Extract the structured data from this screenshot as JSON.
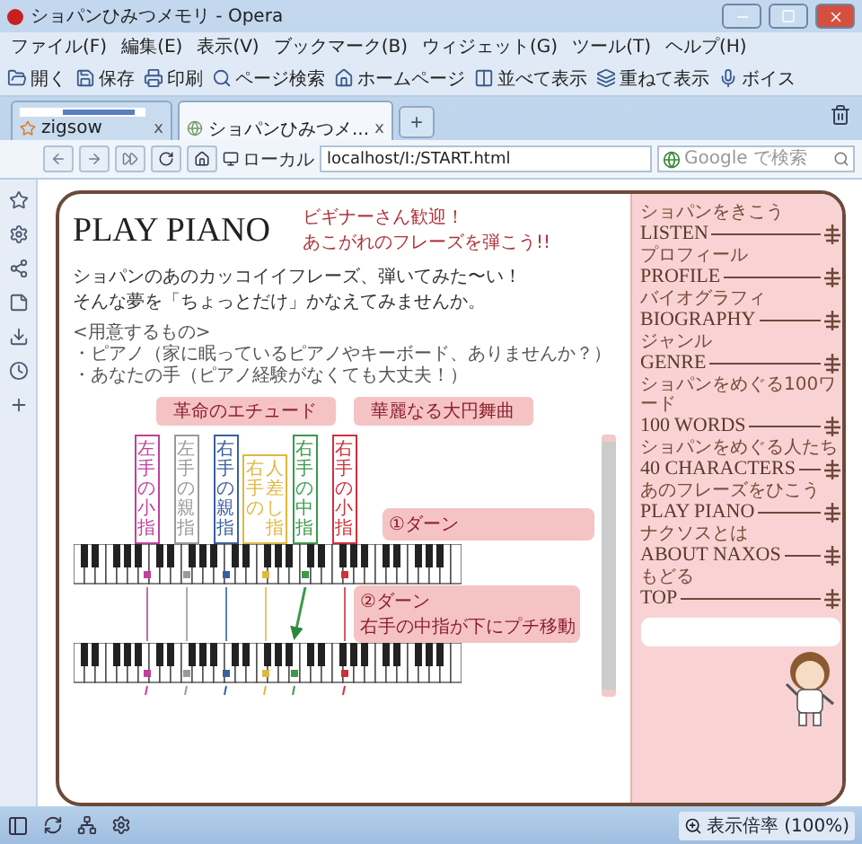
{
  "window": {
    "title": "ショパンひみつメモリ - Opera"
  },
  "menu": [
    "ファイル(F)",
    "編集(E)",
    "表示(V)",
    "ブックマーク(B)",
    "ウィジェット(G)",
    "ツール(T)",
    "ヘルプ(H)"
  ],
  "toolbar": [
    "開く",
    "保存",
    "印刷",
    "ページ検索",
    "ホームページ",
    "並べて表示",
    "重ねて表示",
    "ボイス"
  ],
  "tabs": [
    {
      "title": "zigsow",
      "close": "x",
      "selected": false
    },
    {
      "title": "ショパンひみつメ...",
      "close": "x",
      "selected": true
    }
  ],
  "new_tab": "+",
  "address_bar": {
    "zone": "ローカル",
    "url": "localhost/I:/START.html",
    "search_placeholder": "Google で検索"
  },
  "page": {
    "title": "PLAY PIANO",
    "welcome": [
      "ビギナーさん歓迎！",
      "あこがれのフレーズを弾こう!!"
    ],
    "intro": [
      "ショパンのあのカッコイイフレーズ、弾いてみた〜い！",
      "そんな夢を「ちょっとだけ」かなえてみませんか。"
    ],
    "needs": [
      "<用意するもの>",
      "・ピアノ（家に眠っているピアノやキーボード、ありませんか？）",
      "・あなたの手（ピアノ経験がなくても大丈夫！）"
    ],
    "pieces": [
      "革命のエチュード",
      "華麗なる大円舞曲"
    ],
    "fingers": [
      {
        "lines": [
          "左手の小指"
        ],
        "color": "#c2409c",
        "moves": false
      },
      {
        "lines": [
          "左手の親指"
        ],
        "color": "#9a9a9a",
        "moves": false
      },
      {
        "lines": [
          "右手の親指"
        ],
        "color": "#3a5fa0",
        "moves": false
      },
      {
        "lines": [
          "右手の",
          "人差し指"
        ],
        "color": "#e0b840",
        "moves": false
      },
      {
        "lines": [
          "右手の中指"
        ],
        "color": "#3a9a4a",
        "moves": true
      },
      {
        "lines": [
          "右手の小指"
        ],
        "color": "#d0303a",
        "moves": false
      }
    ],
    "steps": [
      {
        "lines": [
          "①ダーン"
        ]
      },
      {
        "lines": [
          "②ダーン",
          "右手の中指が下にプチ移動"
        ]
      }
    ]
  },
  "nav": [
    {
      "caption": "ショパンをきこう",
      "label": "LISTEN"
    },
    {
      "caption": "プロフィール",
      "label": "PROFILE"
    },
    {
      "caption": "バイオグラフィ",
      "label": "BIOGRAPHY"
    },
    {
      "caption": "ジャンル",
      "label": "GENRE"
    },
    {
      "caption": "ショパンをめぐる100ワード",
      "label": "100 WORDS"
    },
    {
      "caption": "ショパンをめぐる人たち",
      "label": "40 CHARACTERS"
    },
    {
      "caption": "あのフレーズをひこう",
      "label": "PLAY PIANO"
    },
    {
      "caption": "ナクソスとは",
      "label": "ABOUT NAXOS"
    },
    {
      "caption": "もどる",
      "label": "TOP"
    }
  ],
  "status_bar": {
    "zoom": "表示倍率 (100%)"
  }
}
